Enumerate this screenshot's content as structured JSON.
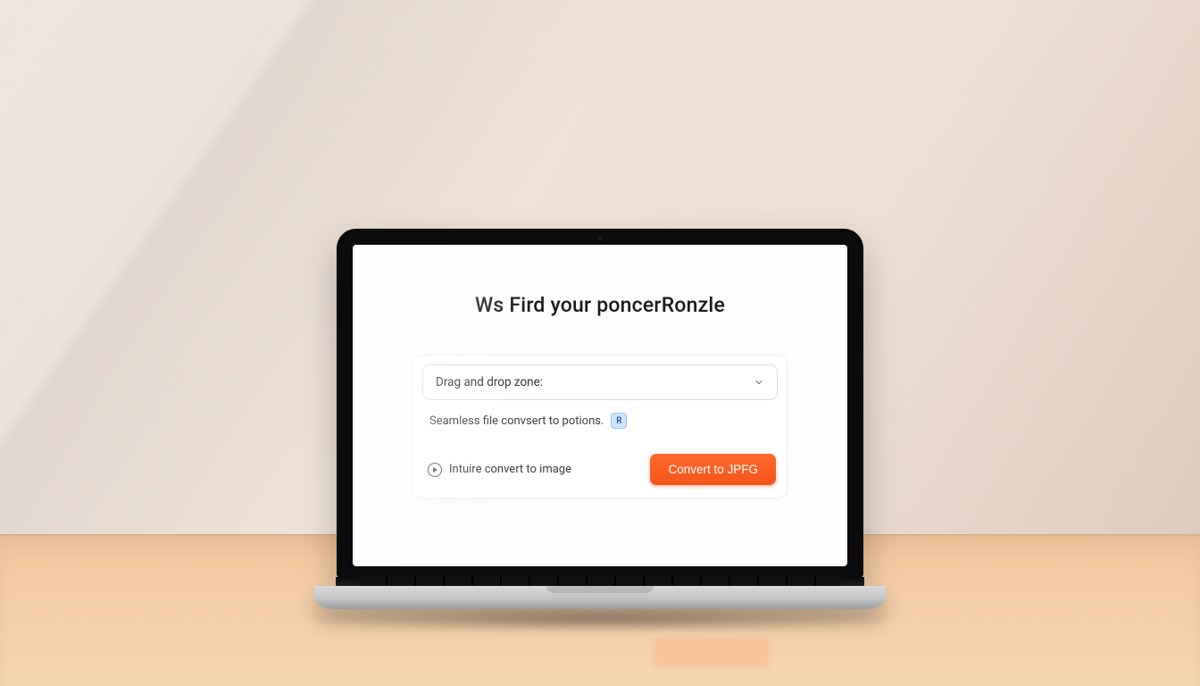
{
  "page": {
    "title": "Ws Fird your poncerRonzle"
  },
  "dropzone": {
    "label": "Drag and drop zone:"
  },
  "options": {
    "text": "Seamless file convsert to potions.",
    "badge": "R"
  },
  "link": {
    "label": "Intuire convert to image"
  },
  "cta": {
    "label": "Convert to JPFG"
  }
}
